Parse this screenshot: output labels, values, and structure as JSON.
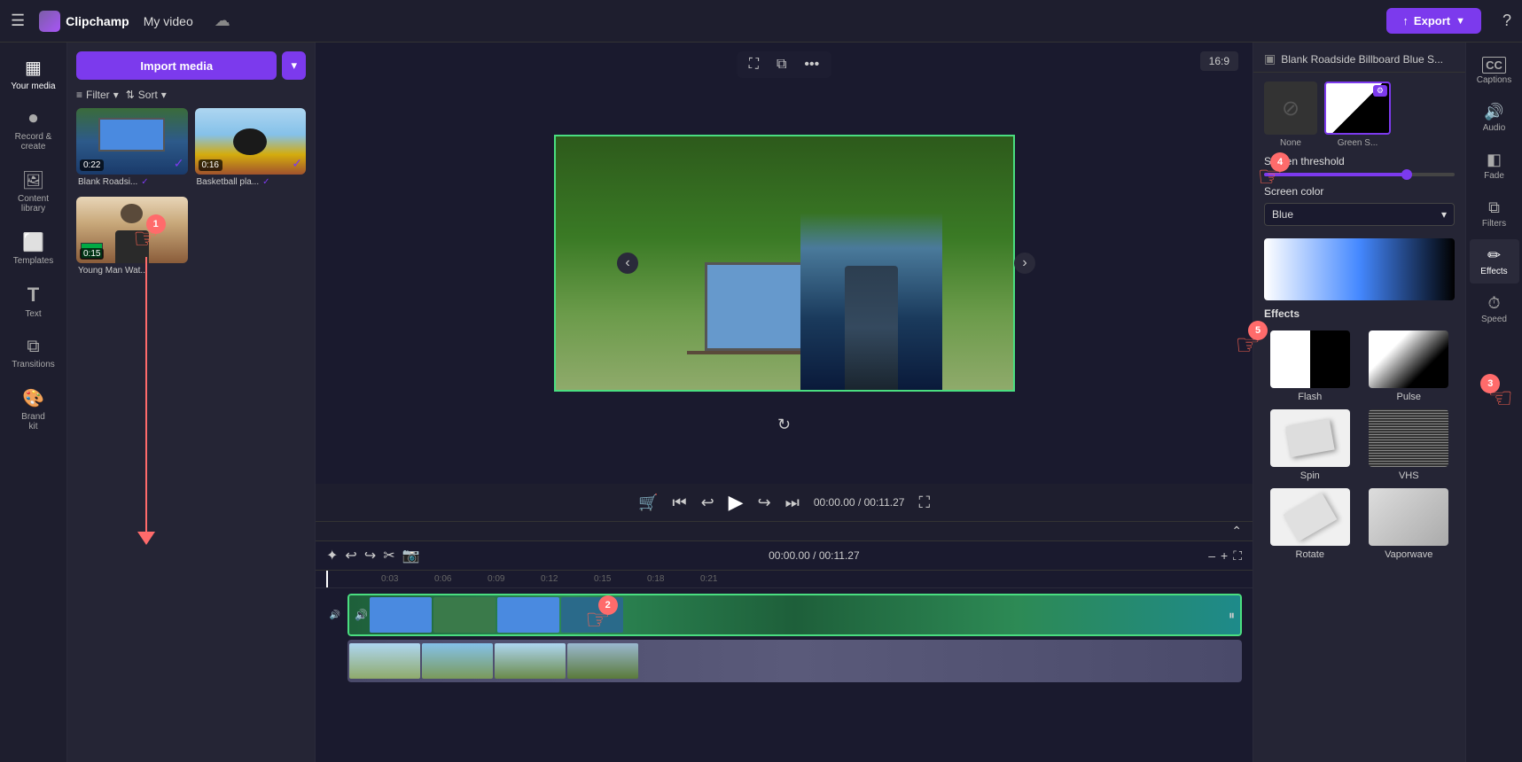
{
  "app": {
    "name": "Clipchamp",
    "video_title": "My video",
    "export_label": "Export"
  },
  "topbar": {
    "hamburger_icon": "☰",
    "logo_text": "Clipchamp",
    "cloud_icon": "☁",
    "help_icon": "?",
    "export_icon": "↑"
  },
  "left_nav": {
    "items": [
      {
        "id": "your-media",
        "label": "Your media",
        "icon": "▦"
      },
      {
        "id": "record-create",
        "label": "Record &\ncreate",
        "icon": "⏺"
      },
      {
        "id": "content-library",
        "label": "Content\nlibrary",
        "icon": "🖼"
      },
      {
        "id": "templates",
        "label": "Templates",
        "icon": "⬜"
      },
      {
        "id": "text",
        "label": "Text",
        "icon": "T"
      },
      {
        "id": "transitions",
        "label": "Transitions",
        "icon": "⧉"
      },
      {
        "id": "brand",
        "label": "Brand\nkit",
        "icon": "🎨"
      }
    ]
  },
  "media_panel": {
    "import_label": "Import media",
    "filter_label": "Filter",
    "sort_label": "Sort",
    "items": [
      {
        "id": "blank-roadside",
        "label": "Blank Roadsi...",
        "duration": "0:22",
        "checked": true
      },
      {
        "id": "basketball",
        "label": "Basketball pla...",
        "duration": "0:16",
        "checked": true
      },
      {
        "id": "young-man",
        "label": "Young Man Wat...",
        "duration": "0:15",
        "checked": false
      }
    ]
  },
  "preview": {
    "ratio": "16:9",
    "time_current": "00:00.00",
    "time_total": "/ 00:11.27"
  },
  "right_panel": {
    "title": "Blank Roadside Billboard Blue S...",
    "none_label": "None",
    "green_label": "Green S...",
    "screen_threshold_label": "Screen threshold",
    "screen_color_label": "Screen color",
    "screen_color_value": "Blue",
    "effects": [
      {
        "id": "flash",
        "label": "Flash",
        "type": "flash"
      },
      {
        "id": "pulse",
        "label": "Pulse",
        "type": "pulse"
      },
      {
        "id": "spin",
        "label": "Spin",
        "type": "spin"
      },
      {
        "id": "vhs",
        "label": "VHS",
        "type": "vhs"
      },
      {
        "id": "rotate",
        "label": "Rotate",
        "type": "rotate"
      },
      {
        "id": "vaporwave",
        "label": "Vaporwave",
        "type": "vaporwave"
      }
    ]
  },
  "far_right_nav": {
    "items": [
      {
        "id": "captions",
        "label": "Captions",
        "icon": "CC"
      },
      {
        "id": "audio",
        "label": "Audio",
        "icon": "🔊"
      },
      {
        "id": "fade",
        "label": "Fade",
        "icon": "◫"
      },
      {
        "id": "filters",
        "label": "Filters",
        "icon": "⧉"
      },
      {
        "id": "effects",
        "label": "Effects",
        "icon": "✏"
      },
      {
        "id": "speed",
        "label": "Speed",
        "icon": "⏱"
      }
    ]
  },
  "timeline": {
    "current_time": "00:00.00",
    "total_time": "/ 00:11.27",
    "markers": [
      "0:03",
      "0:06",
      "0:09",
      "0:12",
      "0:15",
      "0:18",
      "0:21"
    ]
  },
  "annotations": {
    "num1": "1",
    "num2": "2",
    "num3": "3",
    "num4": "4",
    "num5": "5"
  }
}
